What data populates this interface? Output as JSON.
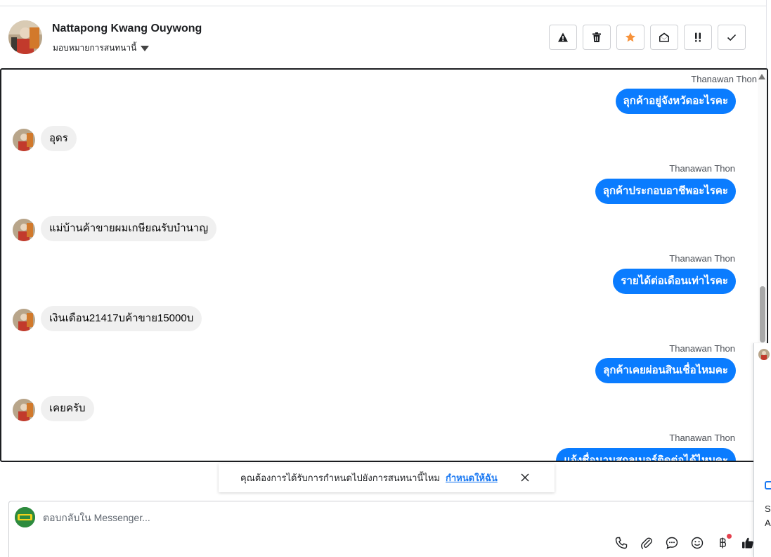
{
  "header": {
    "contact_name": "Nattapong Kwang Ouywong",
    "assign_label": "มอบหมายการสนทนานี้",
    "tool_icons": [
      "warning-icon",
      "trash-icon",
      "star-icon",
      "envelope-open-icon",
      "important-icon",
      "check-icon"
    ],
    "accent_star": "#f7923a"
  },
  "thread": {
    "messages": [
      {
        "direction": "out",
        "sender": "Thanawan Thon",
        "text": "ลุกค้าอยู่จังหวัดอะไรคะ"
      },
      {
        "direction": "in",
        "text": "อุดร"
      },
      {
        "direction": "out",
        "sender": "Thanawan Thon",
        "text": "ลุกค้าประกอบอาชีพอะไรคะ"
      },
      {
        "direction": "in",
        "text": "แม่บ้านค้าขายผมเกษียณรับบำนาญ"
      },
      {
        "direction": "out",
        "sender": "Thanawan Thon",
        "text": "รายได้ต่อเดือนเท่าไรคะ"
      },
      {
        "direction": "in",
        "text": "เงินเดือน21417บค้าขาย15000บ"
      },
      {
        "direction": "out",
        "sender": "Thanawan Thon",
        "text": "ลุกค้าเคยผ่อนสินเชื่อไหมคะ"
      },
      {
        "direction": "in",
        "text": "เคยครับ"
      },
      {
        "direction": "out",
        "sender": "Thanawan Thon",
        "text": "แจ้งชื่อนามสกุลเบอร์ติดต่อได้ไหมคะ"
      }
    ],
    "bubble_out_color": "#0a7cff",
    "bubble_in_color": "#f0f0f0"
  },
  "banner": {
    "text": "คุณต้องการได้รับการกำหนดไปยังการสนทนานี้ไหม",
    "link": "กำหนดให้ฉัน"
  },
  "composer": {
    "placeholder": "ตอบกลับใน Messenger...",
    "tool_icons": [
      "phone-icon",
      "paperclip-icon",
      "chat-bubble-icon",
      "emoji-icon",
      "baht-icon",
      "thumbs-up-icon"
    ]
  },
  "side_panel": {
    "line1": "Se",
    "line2": "A"
  }
}
